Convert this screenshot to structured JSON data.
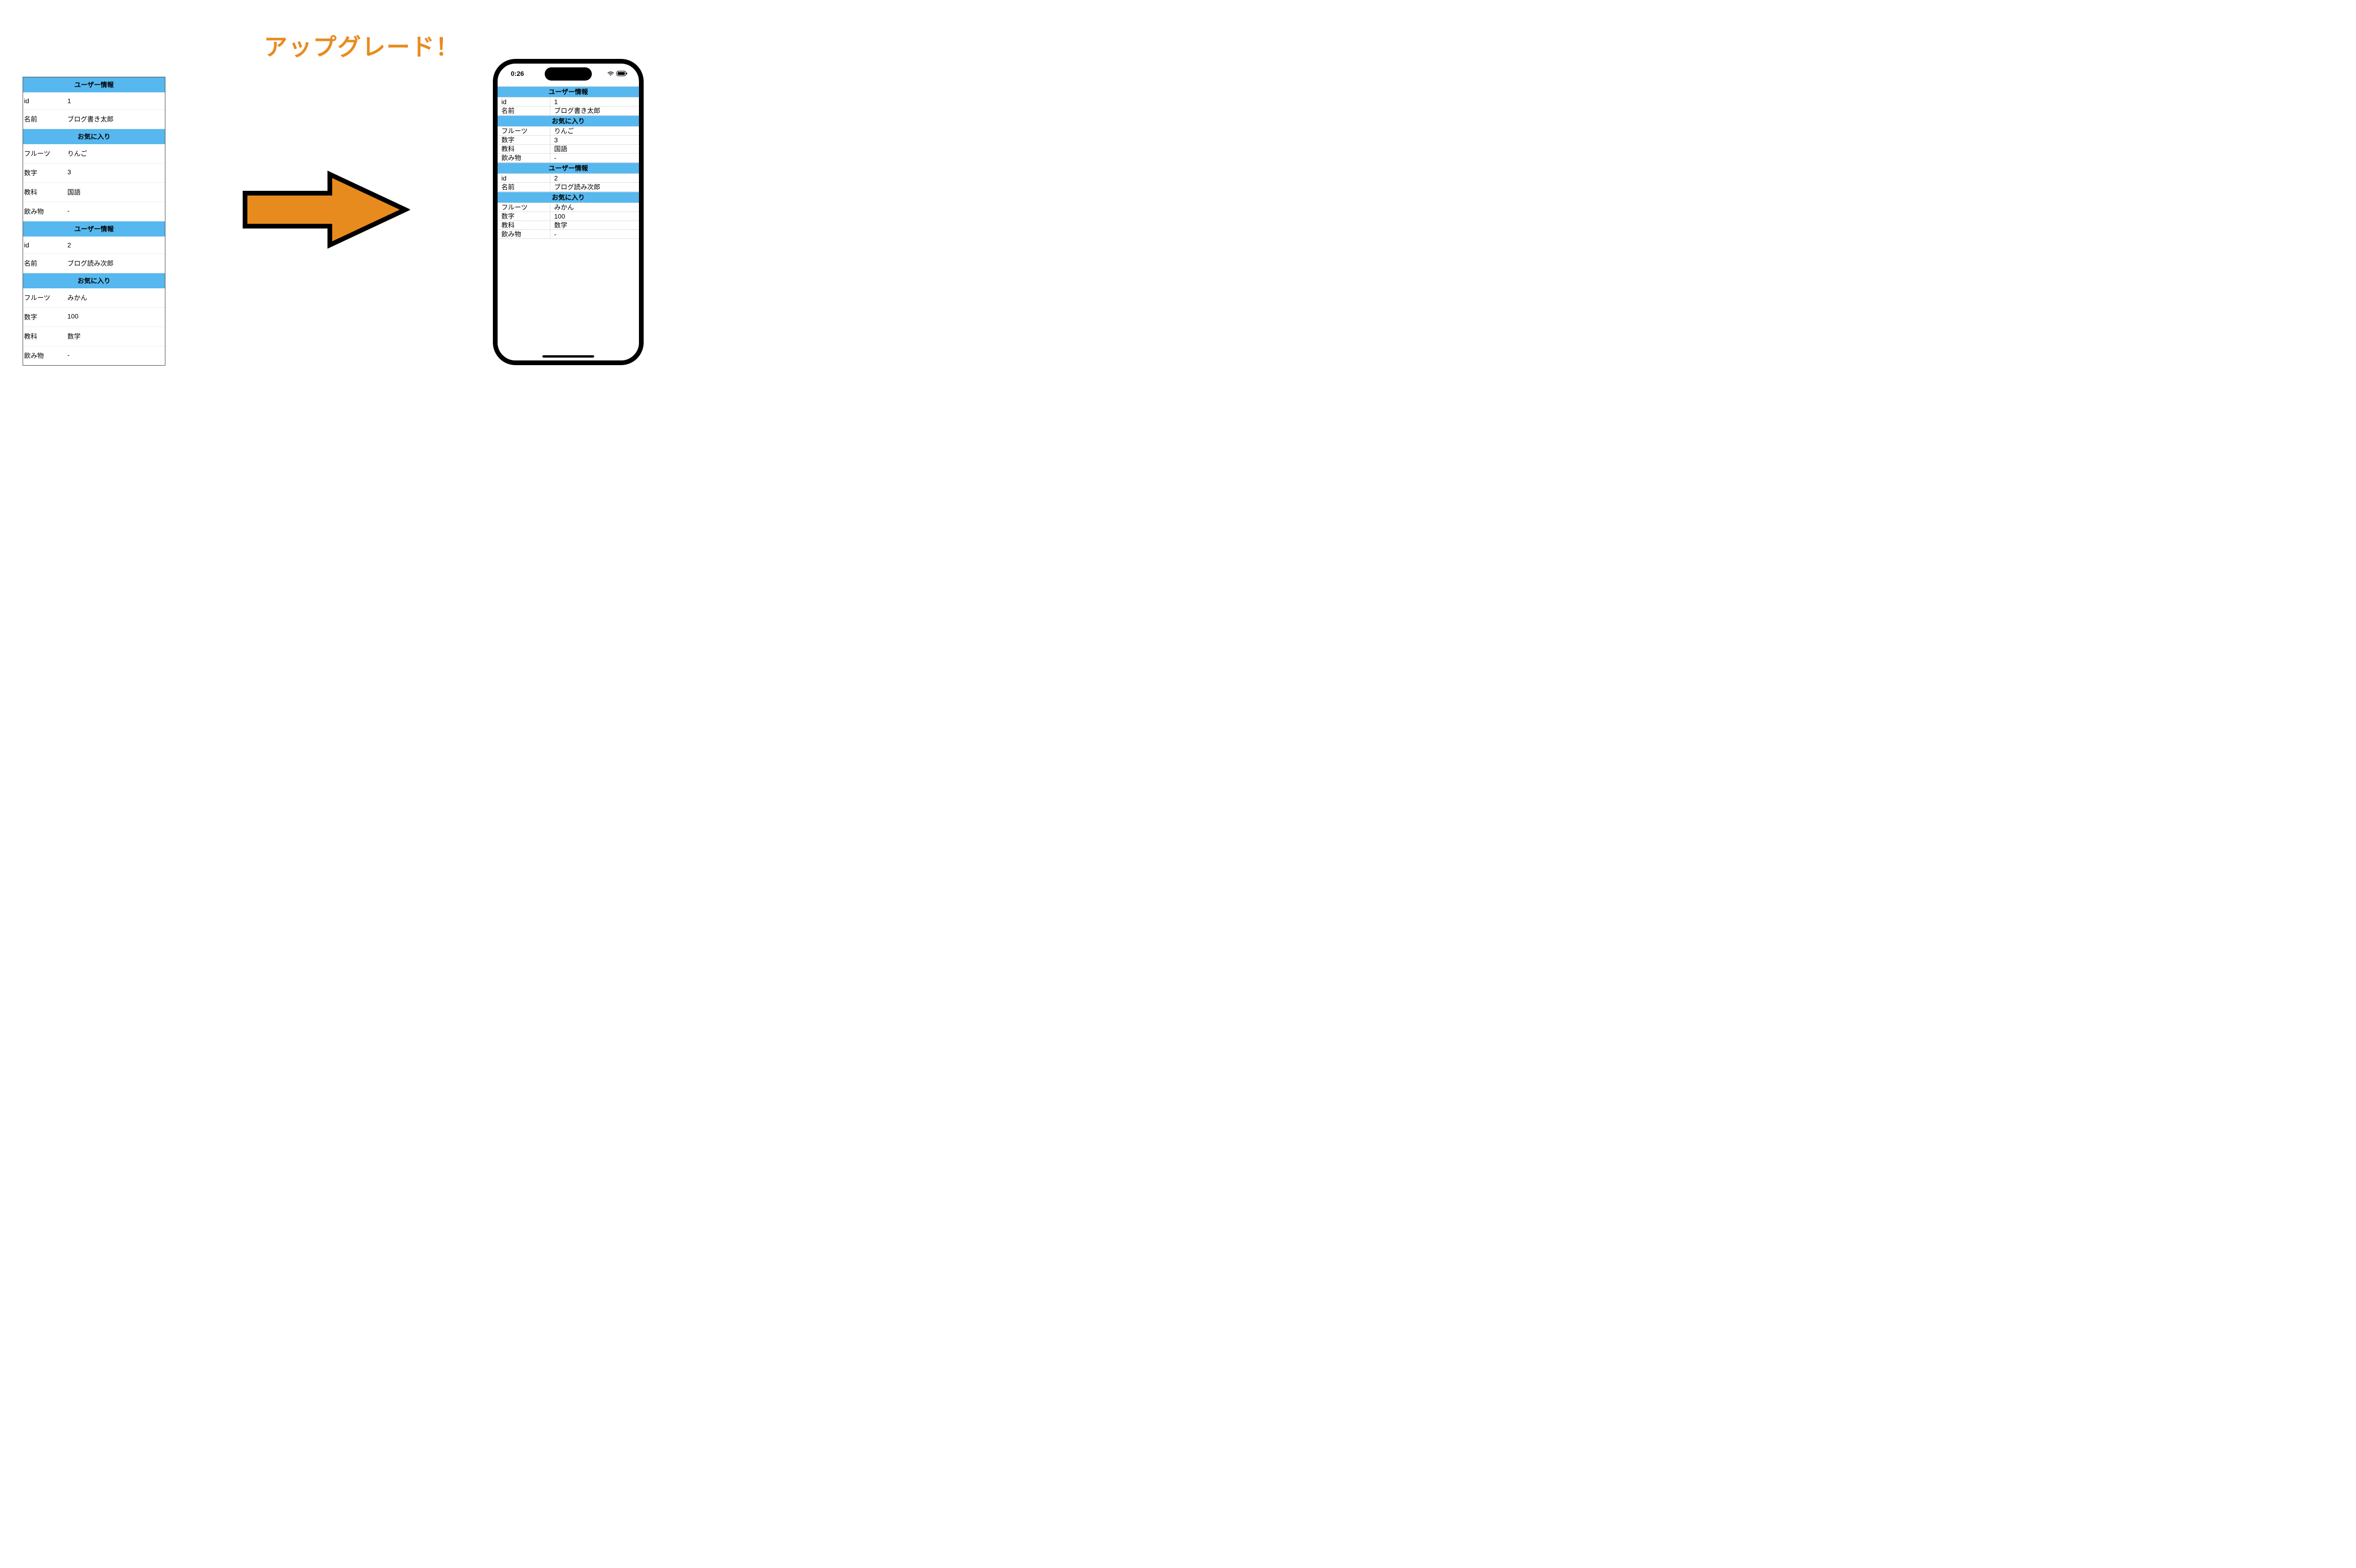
{
  "title": "アップグレード！",
  "phone": {
    "time": "0:26"
  },
  "headers": {
    "user_info": "ユーザー情報",
    "favorites": "お気に入り"
  },
  "labels": {
    "id": "id",
    "name": "名前",
    "fruit": "フルーツ",
    "number": "数字",
    "subject": "教科",
    "drink": "飲み物"
  },
  "users": [
    {
      "id": "1",
      "name": "ブログ書き太郎",
      "favorites": {
        "fruit": "りんご",
        "number": "3",
        "subject": "国語",
        "drink": "-"
      }
    },
    {
      "id": "2",
      "name": "ブログ読み次郎",
      "favorites": {
        "fruit": "みかん",
        "number": "100",
        "subject": "数学",
        "drink": "-"
      }
    }
  ]
}
